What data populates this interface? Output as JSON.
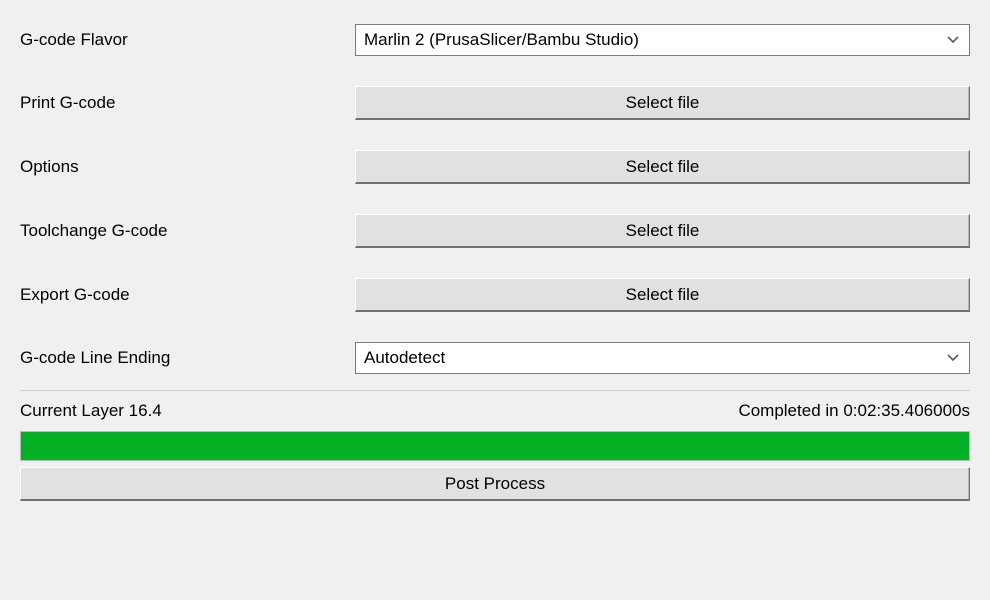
{
  "fields": {
    "gcode_flavor": {
      "label": "G-code Flavor",
      "value": "Marlin 2 (PrusaSlicer/Bambu Studio)"
    },
    "print_gcode": {
      "label": "Print G-code",
      "button": "Select file"
    },
    "options": {
      "label": "Options",
      "button": "Select file"
    },
    "toolchange_gcode": {
      "label": "Toolchange G-code",
      "button": "Select file"
    },
    "export_gcode": {
      "label": "Export G-code",
      "button": "Select file"
    },
    "line_ending": {
      "label": "G-code Line Ending",
      "value": "Autodetect"
    }
  },
  "status": {
    "layer_text": "Current Layer 16.4",
    "completed_text": "Completed in 0:02:35.406000s",
    "progress_percent": 100
  },
  "post_process_button": "Post Process"
}
